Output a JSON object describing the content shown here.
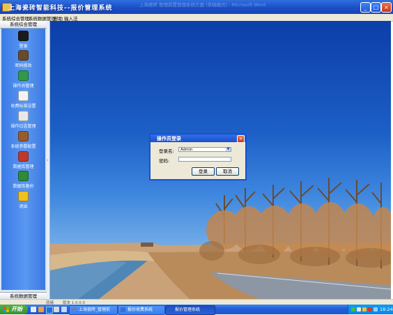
{
  "window": {
    "title": "上海瓷砖智能科技--报价管理系统",
    "background_title": "上海瓷砖 管理前置管理系统方案 (草稿模式) - Microsoft Word"
  },
  "window_controls": {
    "minimize": "_",
    "maximize": "□",
    "close": "×"
  },
  "menubar": {
    "items": [
      "系统综合管理",
      "系统数据管理",
      "帮助",
      "输入法"
    ]
  },
  "sidebar": {
    "header": "系统综合管理",
    "footer": "系统数据管理",
    "items": [
      {
        "label": "登录",
        "icon": "login-icon",
        "color": "#1a1a1a"
      },
      {
        "label": "密码修改",
        "icon": "key-icon",
        "color": "#6b4a2a"
      },
      {
        "label": "操作员管理",
        "icon": "operator-icon",
        "color": "#2f9a4a"
      },
      {
        "label": "收费标准设置",
        "icon": "document-icon",
        "color": "#f4f4f4"
      },
      {
        "label": "操作日志管理",
        "icon": "log-icon",
        "color": "#e8e8e8"
      },
      {
        "label": "系统参数配置",
        "icon": "config-icon",
        "color": "#9a5a2a"
      },
      {
        "label": "数据库管理",
        "icon": "database-icon",
        "color": "#c0392b"
      },
      {
        "label": "数据库备份",
        "icon": "backup-icon",
        "color": "#2f8a3a"
      },
      {
        "label": "退出",
        "icon": "exit-icon",
        "color": "#f0c020"
      }
    ]
  },
  "dialog": {
    "title": "操作员登录",
    "close": "×",
    "username_label": "登录名:",
    "username_value": "Admin",
    "password_label": "密码:",
    "password_value": "",
    "login_button": "登录",
    "cancel_button": "取消"
  },
  "statusbar": {
    "left": "就绪",
    "right": "版本 1.0.0.0"
  },
  "taskbar": {
    "start_label": "开始",
    "buttons": [
      {
        "label": "上海瓷砖_管理前",
        "active": false,
        "icon_color": "#5a7fd6"
      },
      {
        "label": "报价收费系统",
        "active": false,
        "icon_color": "#3a6fd0"
      },
      {
        "label": "报价管理系统",
        "active": true,
        "icon_color": "#2b58c8"
      }
    ],
    "clock": "18:24"
  }
}
